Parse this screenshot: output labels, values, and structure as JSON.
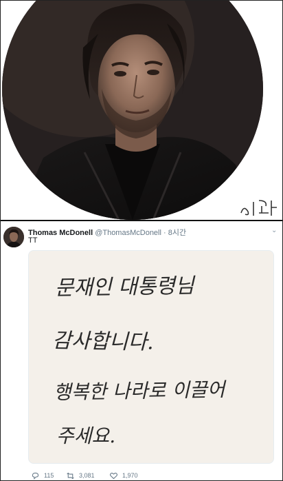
{
  "tweet": {
    "display_name": "Thomas McDonell",
    "handle": "@ThomasMcDonell",
    "separator": "·",
    "time": "8시간",
    "text": "TT",
    "counts": {
      "replies": "115",
      "retweets": "3,081",
      "likes": "1,970"
    }
  },
  "handwritten_note": {
    "lines": [
      "문재인 대통령님",
      "감사합니다.",
      "행복한 나라로 이끌어",
      "주세요."
    ]
  },
  "icons": {
    "reply": "reply-icon",
    "retweet": "retweet-icon",
    "like": "heart-icon",
    "more": "chevron-down-icon"
  },
  "colors": {
    "secondary_text": "#657786",
    "primary_text": "#14171a",
    "paper": "#f4f0ea",
    "ink": "#2a2a2a"
  }
}
